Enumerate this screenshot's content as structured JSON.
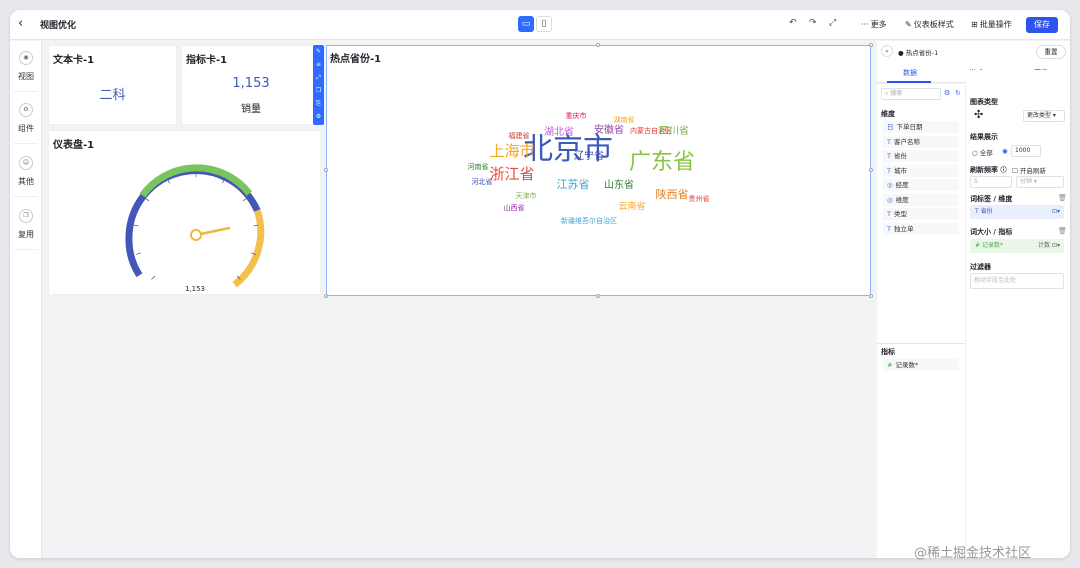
{
  "app": {
    "title": "视图优化"
  },
  "toolbar": {
    "more": "更多",
    "dashboard_style": "仪表板样式",
    "batch": "批量操作",
    "save": "保存"
  },
  "leftnav": {
    "items": [
      "视图",
      "组件",
      "其他",
      "复用"
    ]
  },
  "cards": {
    "text_card": {
      "title": "文本卡-1",
      "value": "二科"
    },
    "metric_card": {
      "title": "指标卡-1",
      "value": "1,153",
      "label": "销量"
    },
    "gauge_card": {
      "title": "仪表盘-1",
      "value_label": "1,153",
      "value_fraction": 0.62
    },
    "wordcloud_card": {
      "title": "热点省份-1",
      "words": [
        {
          "text": "北京市",
          "color": "#3d5bb8"
        },
        {
          "text": "广东省",
          "color": "#8bc34a"
        },
        {
          "text": "上海市",
          "color": "#f5a623"
        },
        {
          "text": "浙江省",
          "color": "#e74c3c"
        },
        {
          "text": "江苏省",
          "color": "#3fa7d6"
        },
        {
          "text": "山东省",
          "color": "#2e7d32"
        },
        {
          "text": "陕西省",
          "color": "#e67e22"
        },
        {
          "text": "湖北省",
          "color": "#c158dc"
        },
        {
          "text": "安徽省",
          "color": "#8e44ad"
        },
        {
          "text": "四川省",
          "color": "#7cb342"
        },
        {
          "text": "辽宁省",
          "color": "#3949ab"
        },
        {
          "text": "湖南省",
          "color": "#f5a623"
        },
        {
          "text": "重庆市",
          "color": "#d81b60"
        },
        {
          "text": "内蒙古自治区",
          "color": "#e53935"
        },
        {
          "text": "福建省",
          "color": "#c0392b"
        },
        {
          "text": "河南省",
          "color": "#2e7d32"
        },
        {
          "text": "河北省",
          "color": "#3f51b5"
        },
        {
          "text": "天津市",
          "color": "#7cb342"
        },
        {
          "text": "山西省",
          "color": "#8e24aa"
        },
        {
          "text": "新疆维吾尔自治区",
          "color": "#3fa7d6"
        },
        {
          "text": "云南省",
          "color": "#f5a623"
        },
        {
          "text": "贵州省",
          "color": "#e53935"
        }
      ]
    }
  },
  "right_panel": {
    "header": "热点省份-1",
    "reset": "重置",
    "tabs": [
      "数据",
      "样式",
      "高级"
    ],
    "search_placeholder": "搜索",
    "dimension_label": "维度",
    "dimension_fields": [
      {
        "icon": "日",
        "name": "下单日期"
      },
      {
        "icon": "T",
        "name": "客户名称"
      },
      {
        "icon": "T",
        "name": "省份"
      },
      {
        "icon": "T",
        "name": "城市"
      },
      {
        "icon": "◎",
        "name": "经度"
      },
      {
        "icon": "◎",
        "name": "维度"
      },
      {
        "icon": "T",
        "name": "类型"
      },
      {
        "icon": "T",
        "name": "独立单"
      }
    ],
    "metric_label": "指标",
    "metric_fields": [
      {
        "icon": "#",
        "name": "记录数*"
      }
    ],
    "chart_type_label": "图表类型",
    "change_type": "更改类型",
    "result_label": "结果展示",
    "result_all": "全部",
    "result_count": "1000",
    "refresh_label": "刷新频率",
    "refresh_toggle": "开启刷新",
    "refresh_value": "5",
    "refresh_unit": "分钟",
    "word_dim_label": "词标签 / 维度",
    "word_dim_chip": "省份",
    "word_size_label": "词大小 / 指标",
    "word_size_chip": "记录数*",
    "word_size_agg": "计数",
    "filter_label": "过滤器",
    "filter_placeholder": "拖动字段至此处"
  },
  "watermark": "@稀土掘金技术社区"
}
